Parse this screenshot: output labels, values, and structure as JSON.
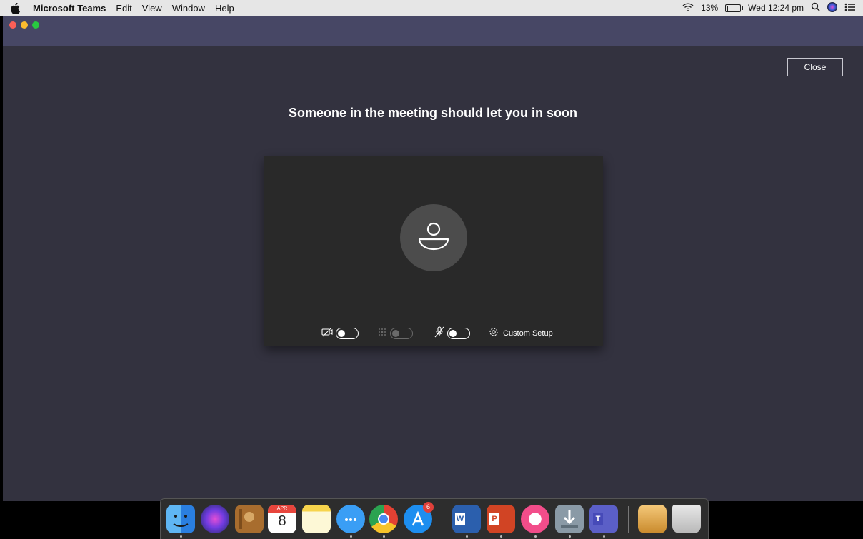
{
  "menubar": {
    "app_name": "Microsoft Teams",
    "menus": [
      "Edit",
      "View",
      "Window",
      "Help"
    ],
    "battery_percent": "13%",
    "battery_level": 0.13,
    "datetime": "Wed 12:24 pm",
    "icons": [
      "apple-icon",
      "wifi-icon",
      "battery-icon",
      "search-icon",
      "siri-icon",
      "control-center-icon"
    ]
  },
  "window": {
    "close_label": "Close",
    "headline": "Someone in the meeting should let you in soon"
  },
  "preview": {
    "video_toggle": "off",
    "blur_toggle": "off-disabled",
    "mic_toggle": "off",
    "custom_setup_label": "Custom Setup"
  },
  "dock": {
    "apps": [
      "Finder",
      "Siri",
      "Contacts",
      "Calendar",
      "Notes",
      "Messages",
      "Chrome",
      "App Store",
      "Word",
      "PowerPoint",
      "iTunes",
      "Downloads",
      "Teams",
      "Archive",
      "Trash"
    ],
    "calendar_month": "APR",
    "calendar_day": "8",
    "appstore_badge": "6"
  },
  "colors": {
    "titlebar": "#474765",
    "window_bg": "#33323f",
    "preview_bg": "#292929"
  }
}
